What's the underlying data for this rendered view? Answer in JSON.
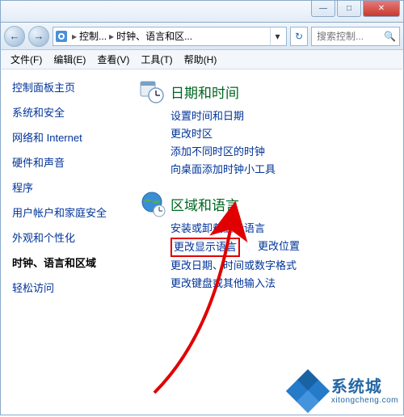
{
  "titlebar": {
    "minimize": "—",
    "maximize": "□",
    "close": "✕"
  },
  "nav": {
    "back": "←",
    "forward": "→",
    "bc1": "控制...",
    "bc2": "时钟、语言和区...",
    "dropdown": "▾",
    "refresh": "↻"
  },
  "search": {
    "placeholder": "搜索控制...",
    "icon": "🔍"
  },
  "menu": {
    "file": "文件(F)",
    "edit": "编辑(E)",
    "view": "查看(V)",
    "tools": "工具(T)",
    "help": "帮助(H)"
  },
  "sidebar": {
    "home": "控制面板主页",
    "items": [
      "系统和安全",
      "网络和 Internet",
      "硬件和声音",
      "程序",
      "用户帐户和家庭安全",
      "外观和个性化",
      "时钟、语言和区域",
      "轻松访问"
    ],
    "active_index": 6
  },
  "content": {
    "section1": {
      "title": "日期和时间",
      "links": [
        "设置时间和日期",
        "更改时区",
        "添加不同时区的时钟",
        "向桌面添加时钟小工具"
      ]
    },
    "section2": {
      "title": "区域和语言",
      "links": {
        "install": "安装或卸载显示语言",
        "change_display_lang": "更改显示语言",
        "change_location": "更改位置",
        "change_datefmt": "更改日期、时间或数字格式",
        "change_keyboard": "更改键盘或其他输入法"
      }
    }
  },
  "watermark": {
    "title": "系统城",
    "sub": "xitongcheng.com"
  }
}
